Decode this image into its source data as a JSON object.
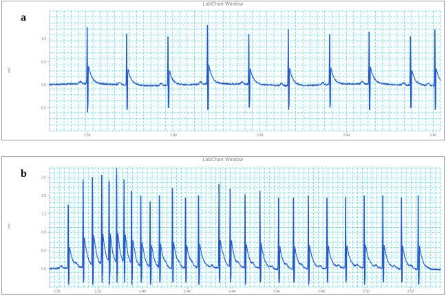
{
  "figure": {
    "panel_a": {
      "letter": "a",
      "window_title": "LabChart Window"
    },
    "panel_b": {
      "letter": "b",
      "window_title": "LabChart Window"
    }
  },
  "colors": {
    "trace": "#1f57d6",
    "grid": "#3ed6e0",
    "frame": "#9a9a9a",
    "tick_text": "#777777"
  },
  "chart_data": [
    {
      "panel": "a",
      "type": "line",
      "title": "LabChart Window",
      "xlabel": "",
      "ylabel": "mV",
      "xlim": [
        0,
        10.4
      ],
      "ylim": [
        -1.0,
        1.6
      ],
      "x_ticks": [
        {
          "value": 1.0,
          "label": "2:38"
        },
        {
          "value": 3.3,
          "label": "2:40"
        },
        {
          "value": 5.6,
          "label": "2:42"
        },
        {
          "value": 7.9,
          "label": "2:44"
        },
        {
          "value": 10.2,
          "label": "2:46"
        }
      ],
      "y_ticks": [
        {
          "value": 1.0,
          "label": "1.0"
        },
        {
          "value": 0.5,
          "label": "0.5"
        },
        {
          "value": 0.0,
          "label": "0.0"
        },
        {
          "value": -0.5,
          "label": "-0.5"
        }
      ],
      "grid": true,
      "beats": [
        {
          "t": 1.0,
          "peak": 1.25,
          "trough": -0.6
        },
        {
          "t": 2.05,
          "peak": 1.1,
          "trough": -0.55
        },
        {
          "t": 3.15,
          "peak": 1.05,
          "trough": -0.5
        },
        {
          "t": 4.2,
          "peak": 1.3,
          "trough": -0.55
        },
        {
          "t": 5.3,
          "peak": 1.1,
          "trough": -0.5
        },
        {
          "t": 6.35,
          "peak": 1.2,
          "trough": -0.55
        },
        {
          "t": 7.45,
          "peak": 1.1,
          "trough": -0.5
        },
        {
          "t": 8.5,
          "peak": 1.15,
          "trough": -0.55
        },
        {
          "t": 9.6,
          "peak": 1.05,
          "trough": -0.5
        },
        {
          "t": 10.25,
          "peak": 1.2,
          "trough": -0.55
        }
      ]
    },
    {
      "panel": "b",
      "type": "line",
      "title": "LabChart Window",
      "xlabel": "",
      "ylabel": "mV",
      "xlim": [
        0,
        10.5
      ],
      "ylim": [
        -0.4,
        2.2
      ],
      "x_ticks": [
        {
          "value": 0.2,
          "label": "2:36"
        },
        {
          "value": 1.3,
          "label": "2:38"
        },
        {
          "value": 2.5,
          "label": "2:40"
        },
        {
          "value": 3.7,
          "label": "2:42"
        },
        {
          "value": 4.9,
          "label": "2:44"
        },
        {
          "value": 6.1,
          "label": "2:46"
        },
        {
          "value": 7.3,
          "label": "2:48"
        },
        {
          "value": 8.5,
          "label": "2:50"
        },
        {
          "value": 9.7,
          "label": "2:52"
        }
      ],
      "y_ticks": [
        {
          "value": 2.0,
          "label": "2.0"
        },
        {
          "value": 1.6,
          "label": "1.6"
        },
        {
          "value": 1.2,
          "label": "1.2"
        },
        {
          "value": 0.8,
          "label": "0.8"
        },
        {
          "value": 0.4,
          "label": "0.4"
        },
        {
          "value": 0.0,
          "label": "0.0"
        }
      ],
      "grid": true,
      "beats": [
        {
          "t": 0.5,
          "peak": 1.4,
          "trough": -0.35
        },
        {
          "t": 0.9,
          "peak": 1.9,
          "trough": -0.3
        },
        {
          "t": 1.15,
          "peak": 2.0,
          "trough": -0.35
        },
        {
          "t": 1.4,
          "peak": 2.05,
          "trough": -0.3
        },
        {
          "t": 1.6,
          "peak": 1.9,
          "trough": -0.35
        },
        {
          "t": 1.8,
          "peak": 2.05,
          "trough": -0.3
        },
        {
          "t": 2.0,
          "peak": 1.95,
          "trough": -0.3
        },
        {
          "t": 2.2,
          "peak": 1.7,
          "trough": -0.35
        },
        {
          "t": 2.45,
          "peak": 1.6,
          "trough": -0.3
        },
        {
          "t": 2.7,
          "peak": 1.45,
          "trough": -0.35
        },
        {
          "t": 2.95,
          "peak": 1.6,
          "trough": -0.3
        },
        {
          "t": 3.3,
          "peak": 1.75,
          "trough": -0.3
        },
        {
          "t": 3.65,
          "peak": 1.55,
          "trough": -0.3
        },
        {
          "t": 4.0,
          "peak": 1.6,
          "trough": -0.35
        },
        {
          "t": 4.55,
          "peak": 1.85,
          "trough": -0.3
        },
        {
          "t": 4.85,
          "peak": 1.75,
          "trough": -0.3
        },
        {
          "t": 5.25,
          "peak": 1.6,
          "trough": -0.35
        },
        {
          "t": 5.65,
          "peak": 1.7,
          "trough": -0.3
        },
        {
          "t": 6.15,
          "peak": 1.55,
          "trough": -0.3
        },
        {
          "t": 6.55,
          "peak": 1.55,
          "trough": -0.3
        },
        {
          "t": 6.95,
          "peak": 1.6,
          "trough": -0.35
        },
        {
          "t": 7.45,
          "peak": 1.55,
          "trough": -0.3
        },
        {
          "t": 7.95,
          "peak": 1.55,
          "trough": -0.3
        },
        {
          "t": 8.45,
          "peak": 1.6,
          "trough": -0.35
        },
        {
          "t": 8.95,
          "peak": 1.6,
          "trough": -0.3
        },
        {
          "t": 9.45,
          "peak": 1.55,
          "trough": -0.3
        },
        {
          "t": 9.9,
          "peak": 1.6,
          "trough": -0.35
        }
      ]
    }
  ]
}
